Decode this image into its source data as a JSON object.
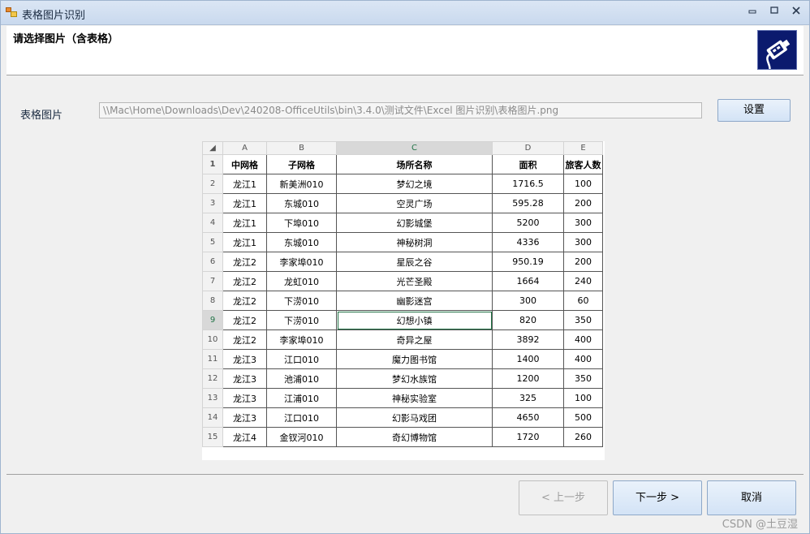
{
  "window": {
    "title": "表格图片识别",
    "minimize": "▭",
    "maximize": "▢",
    "close": "✕"
  },
  "header": {
    "instruction": "请选择图片（含表格）"
  },
  "form": {
    "label": "表格图片",
    "path_value": "\\\\Mac\\Home\\Downloads\\Dev\\240208-OfficeUtils\\bin\\3.4.0\\测试文件\\Excel 图片识别\\表格图片.png",
    "settings_button": "设置"
  },
  "sheet": {
    "corner": "◢",
    "columns": [
      "A",
      "B",
      "C",
      "D",
      "E"
    ],
    "selected_column": "C",
    "header_row_number": "1",
    "header": [
      "中网格",
      "子网格",
      "场所名称",
      "面积",
      "旅客人数"
    ],
    "rows": [
      {
        "n": "2",
        "cells": [
          "龙江1",
          "新美洲010",
          "梦幻之境",
          "1716.5",
          "100"
        ]
      },
      {
        "n": "3",
        "cells": [
          "龙江1",
          "东城010",
          "空灵广场",
          "595.28",
          "200"
        ]
      },
      {
        "n": "4",
        "cells": [
          "龙江1",
          "下埠010",
          "幻影城堡",
          "5200",
          "300"
        ]
      },
      {
        "n": "5",
        "cells": [
          "龙江1",
          "东城010",
          "神秘树洞",
          "4336",
          "300"
        ]
      },
      {
        "n": "6",
        "cells": [
          "龙江2",
          "李家埠010",
          "星辰之谷",
          "950.19",
          "200"
        ]
      },
      {
        "n": "7",
        "cells": [
          "龙江2",
          "龙虹010",
          "光芒圣殿",
          "1664",
          "240"
        ]
      },
      {
        "n": "8",
        "cells": [
          "龙江2",
          "下涝010",
          "幽影迷宫",
          "300",
          "60"
        ]
      },
      {
        "n": "9",
        "cells": [
          "龙江2",
          "下涝010",
          "幻想小镇",
          "820",
          "350"
        ]
      },
      {
        "n": "10",
        "cells": [
          "龙江2",
          "李家埠010",
          "奇异之屋",
          "3892",
          "400"
        ]
      },
      {
        "n": "11",
        "cells": [
          "龙江3",
          "江口010",
          "魔力图书馆",
          "1400",
          "400"
        ]
      },
      {
        "n": "12",
        "cells": [
          "龙江3",
          "池浦010",
          "梦幻水族馆",
          "1200",
          "350"
        ]
      },
      {
        "n": "13",
        "cells": [
          "龙江3",
          "江浦010",
          "神秘实验室",
          "325",
          "100"
        ]
      },
      {
        "n": "14",
        "cells": [
          "龙江3",
          "江口010",
          "幻影马戏团",
          "4650",
          "500"
        ]
      },
      {
        "n": "15",
        "cells": [
          "龙江4",
          "金钗河010",
          "奇幻博物馆",
          "1720",
          "260"
        ]
      }
    ],
    "selected_row": "9"
  },
  "footer": {
    "prev_button": "< 上一步",
    "next_button": "下一步 >",
    "cancel_button": "取消"
  },
  "watermark": "CSDN @土豆湿"
}
